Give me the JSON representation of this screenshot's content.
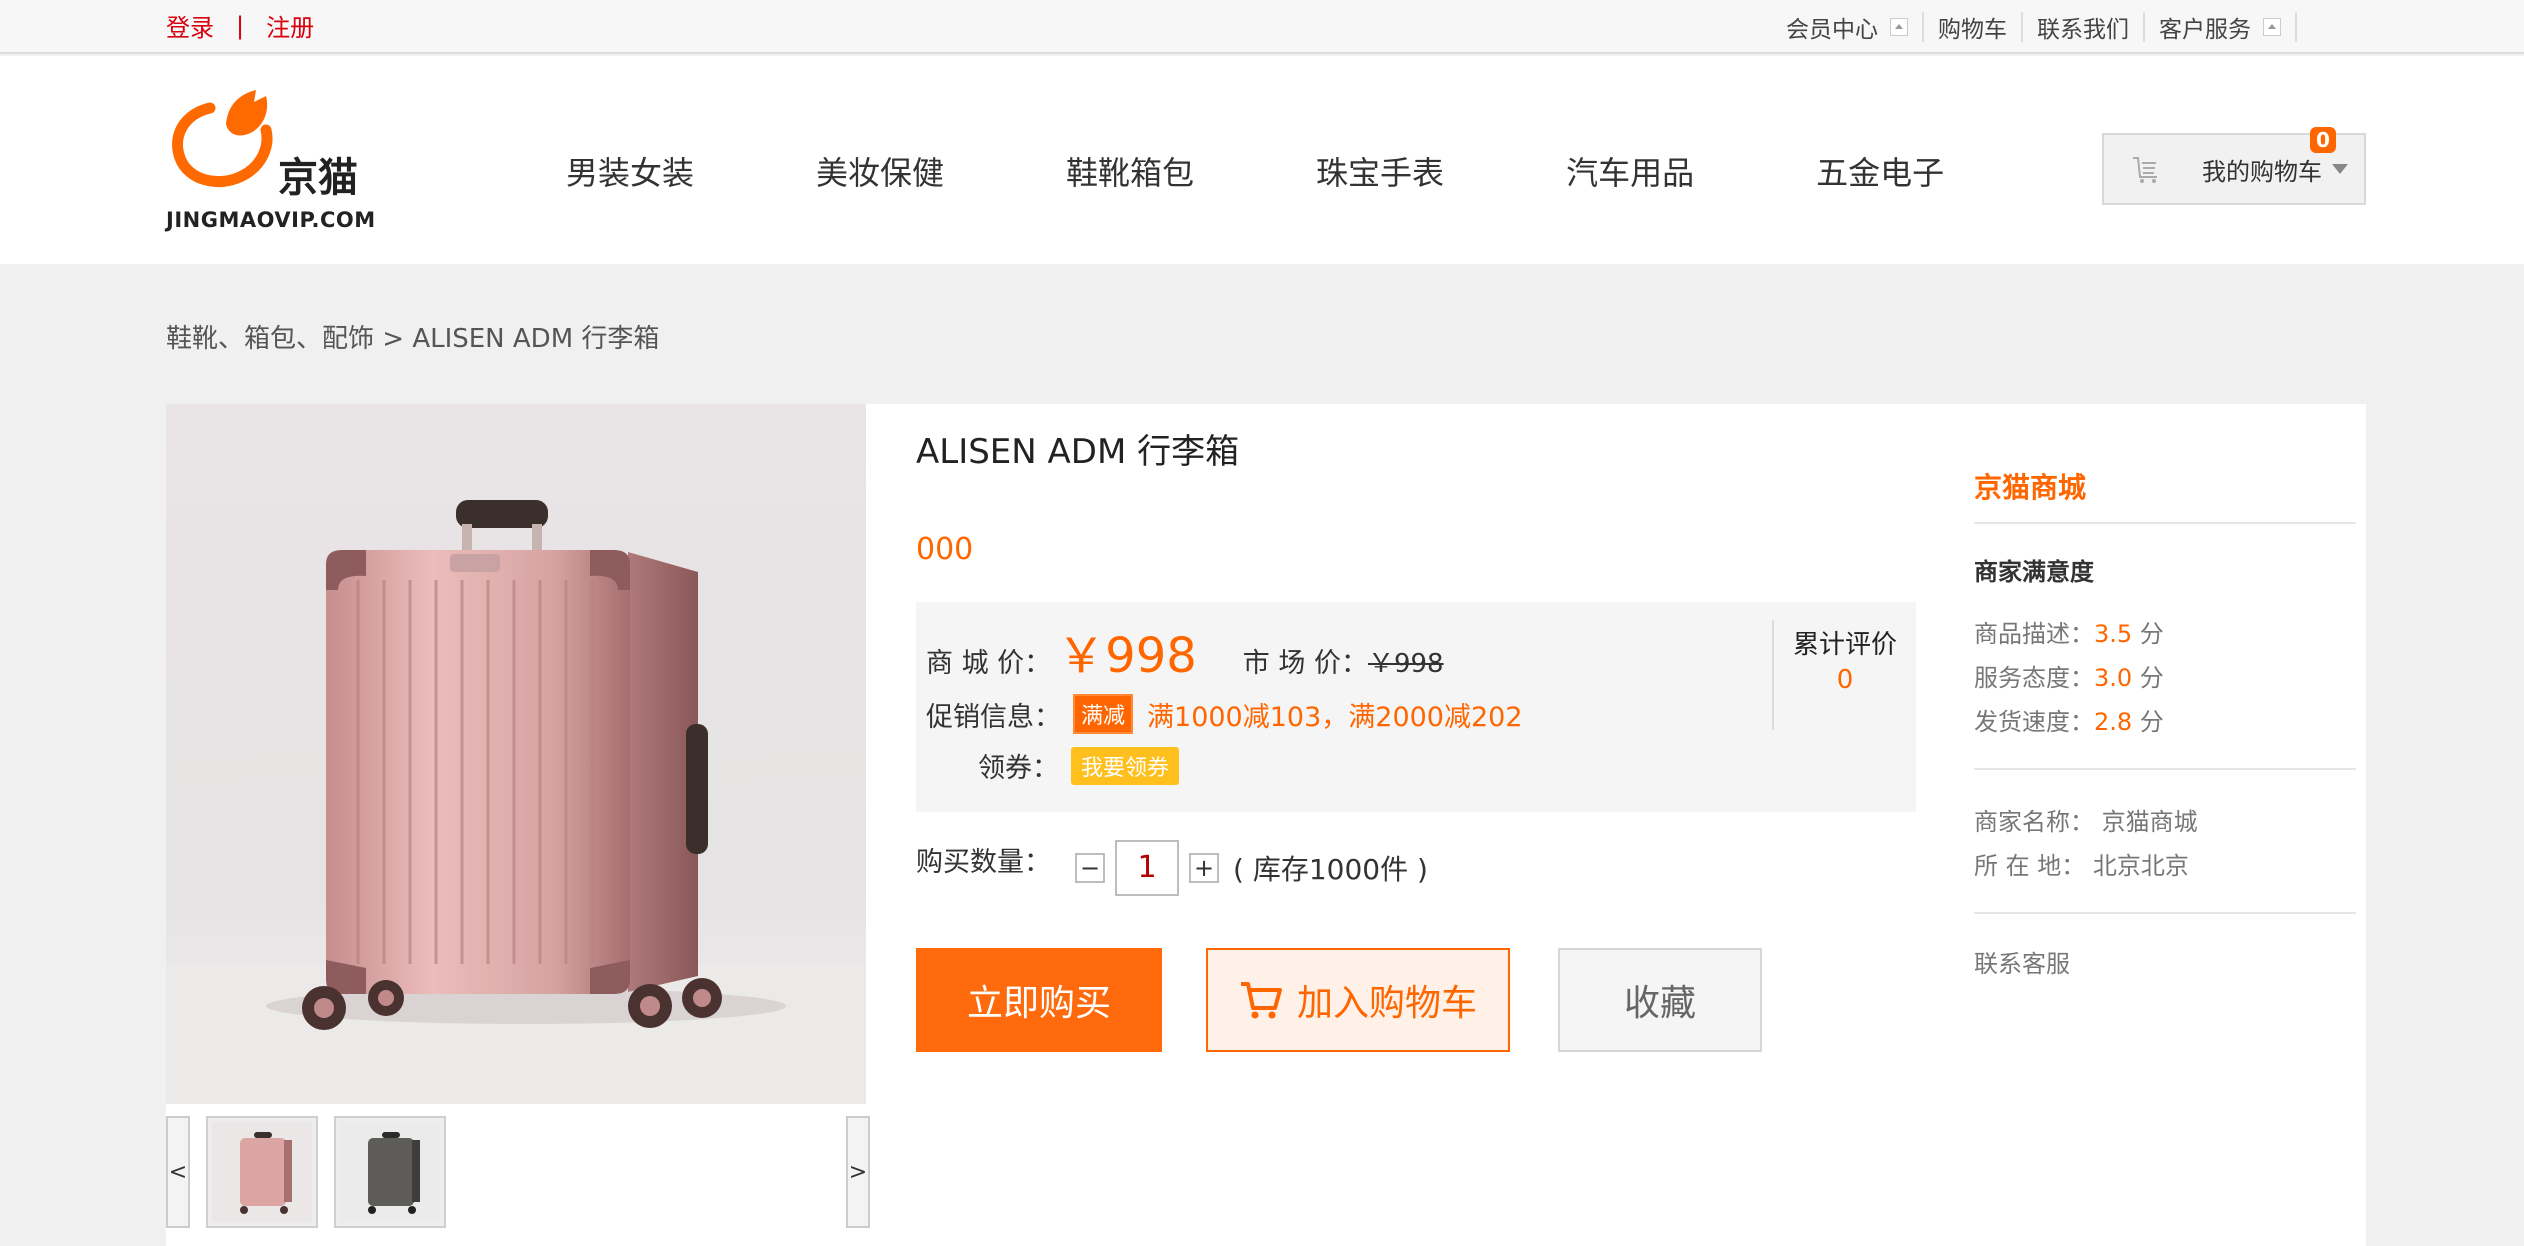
{
  "topbar": {
    "login": "登录",
    "separator": "|",
    "register": "注册",
    "links": [
      "会员中心",
      "购物车",
      "联系我们",
      "客户服务"
    ]
  },
  "header": {
    "logo_cn": "京猫",
    "logo_en": "JINGMAOVIP.COM",
    "nav": [
      "男装女装",
      "美妆保健",
      "鞋靴箱包",
      "珠宝手表",
      "汽车用品",
      "五金电子"
    ],
    "cart_label": "我的购物车",
    "cart_count": "0"
  },
  "breadcrumb": "鞋靴、箱包、配饰 > ALISEN ADM 行李箱",
  "gallery": {
    "prev": "<",
    "next": ">"
  },
  "product": {
    "title": "ALISEN ADM 行李箱",
    "subtitle": "000",
    "mall_price_label": "商 城 价：",
    "mall_price": "￥998",
    "market_price_label": "市 场 价：",
    "market_price": "￥998",
    "reviews_label": "累计评价",
    "reviews_count": "0",
    "promo_label": "促销信息：",
    "promo_tag": "满减",
    "promo_text": "满1000减103，满2000减202",
    "coupon_label": "领券：",
    "coupon_button": "我要领券",
    "qty_label": "购买数量：",
    "qty_minus": "−",
    "qty_value": "1",
    "qty_plus": "+",
    "stock": "( 库存1000件 )",
    "buy_now": "立即购买",
    "add_to_cart": "加入购物车",
    "favorite": "收藏"
  },
  "seller": {
    "name": "京猫商城",
    "satisfaction_title": "商家满意度",
    "scores": [
      {
        "label": "商品描述：",
        "value": "3.5",
        "unit": " 分"
      },
      {
        "label": "服务态度：",
        "value": "3.0",
        "unit": " 分"
      },
      {
        "label": "发货速度：",
        "value": "2.8",
        "unit": " 分"
      }
    ],
    "shop_name_label": "商家名称：",
    "shop_name": "京猫商城",
    "location_label": "所 在 地：",
    "location": "北京北京",
    "contact": "联系客服"
  },
  "colors": {
    "accent": "#ff6600",
    "login_red": "#d8000c",
    "coupon": "#ffc01e"
  }
}
